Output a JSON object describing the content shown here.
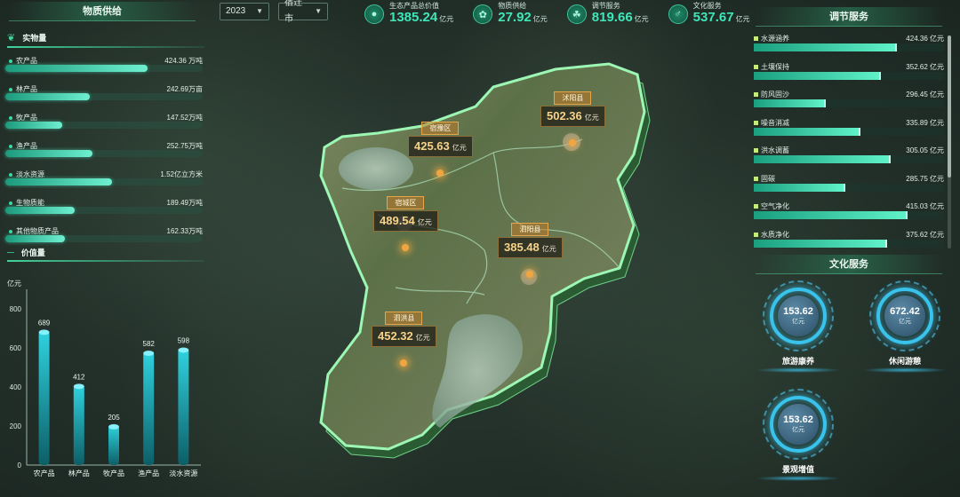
{
  "headers": {
    "left": "物质供给",
    "right_top": "调节服务",
    "right_bottom": "文化服务"
  },
  "filters": {
    "year": "2023",
    "city": "宿迁市"
  },
  "kpis": [
    {
      "label": "生态产品总价值",
      "value": "1385.24",
      "unit": "亿元",
      "icon": "leaf-circle-icon"
    },
    {
      "label": "物质供给",
      "value": "27.92",
      "unit": "亿元",
      "icon": "sprout-icon"
    },
    {
      "label": "调节服务",
      "value": "819.66",
      "unit": "亿元",
      "icon": "plant-icon"
    },
    {
      "label": "文化服务",
      "value": "537.67",
      "unit": "亿元",
      "icon": "culture-icon"
    }
  ],
  "physical": {
    "title": "实物量",
    "items": [
      {
        "name": "农产品",
        "amount": "424.36 万吨",
        "fraction": 0.72
      },
      {
        "name": "林产品",
        "amount": "242.69万亩",
        "fraction": 0.43
      },
      {
        "name": "牧产品",
        "amount": "147.52万吨",
        "fraction": 0.29
      },
      {
        "name": "渔产品",
        "amount": "252.75万吨",
        "fraction": 0.44
      },
      {
        "name": "淡水资源",
        "amount": "1.52亿立方米",
        "fraction": 0.54
      },
      {
        "name": "生物质能",
        "amount": "189.49万吨",
        "fraction": 0.35
      },
      {
        "name": "其他物质产品",
        "amount": "162.33万吨",
        "fraction": 0.3
      }
    ]
  },
  "value_section": {
    "title": "价值量"
  },
  "chart_data": {
    "type": "bar",
    "categories": [
      "农产品",
      "林产品",
      "牧产品",
      "渔产品",
      "淡水资源"
    ],
    "values": [
      689,
      412,
      205,
      582,
      598
    ],
    "title": "",
    "xlabel": "",
    "ylabel": "亿元",
    "ylim": [
      0,
      800
    ],
    "yticks": [
      0,
      200,
      400,
      600,
      800
    ],
    "grid": false,
    "data_labels": true
  },
  "districts": [
    {
      "name": "沭阳县",
      "value": "502.36",
      "unit": "亿元"
    },
    {
      "name": "宿豫区",
      "value": "425.63",
      "unit": "亿元"
    },
    {
      "name": "宿城区",
      "value": "489.54",
      "unit": "亿元"
    },
    {
      "name": "泗阳县",
      "value": "385.48",
      "unit": "亿元"
    },
    {
      "name": "泗洪县",
      "value": "452.32",
      "unit": "亿元"
    }
  ],
  "regulation": [
    {
      "name": "水源涵养",
      "amount": "424.36 亿元",
      "fraction": 0.75
    },
    {
      "name": "土壤保持",
      "amount": "352.62 亿元",
      "fraction": 0.67
    },
    {
      "name": "防风固沙",
      "amount": "296.45 亿元",
      "fraction": 0.38
    },
    {
      "name": "噪音消减",
      "amount": "335.89 亿元",
      "fraction": 0.56
    },
    {
      "name": "洪水调蓄",
      "amount": "305.05 亿元",
      "fraction": 0.72
    },
    {
      "name": "固碳",
      "amount": "285.75 亿元",
      "fraction": 0.48
    },
    {
      "name": "空气净化",
      "amount": "415.03 亿元",
      "fraction": 0.81
    },
    {
      "name": "水质净化",
      "amount": "375.62 亿元",
      "fraction": 0.7
    }
  ],
  "culture": [
    {
      "name": "旅游康养",
      "value": "153.62",
      "unit": "亿元"
    },
    {
      "name": "休闲游憩",
      "value": "672.42",
      "unit": "亿元"
    },
    {
      "name": "景观增值",
      "value": "153.62",
      "unit": "亿元"
    }
  ],
  "colors": {
    "accent": "#3ee6b8",
    "bar_gradient_top": "#2fd3e0",
    "bar_gradient_bottom": "#0d5e66",
    "map_outline": "#9cf7b4",
    "label_orange": "#f7d28a",
    "culture_ring": "#39c3ec"
  }
}
